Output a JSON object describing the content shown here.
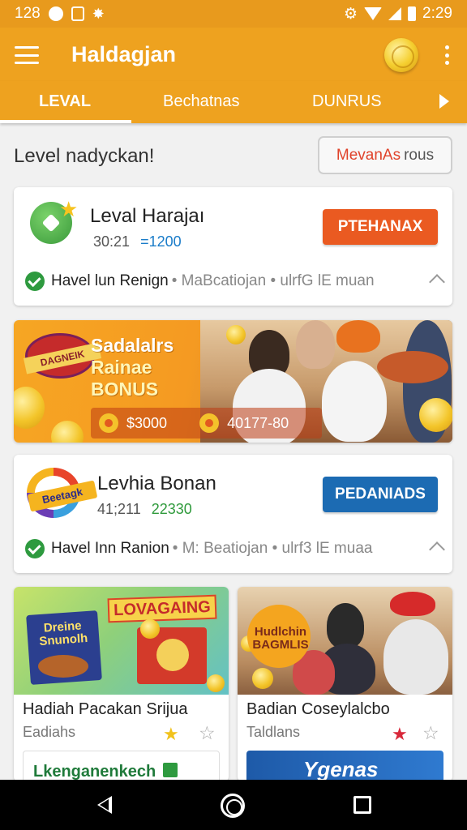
{
  "status_bar": {
    "left_text": "128",
    "time": "2:29",
    "icons": [
      "notification-icon",
      "grid-icon",
      "star-icon",
      "settings-icon",
      "wifi-icon",
      "signal-icon",
      "battery-icon"
    ]
  },
  "app_bar": {
    "title": "Haldagjan",
    "icons": [
      "menu-icon",
      "coin-icon",
      "more-vert-icon"
    ]
  },
  "tabs": [
    {
      "label": "LEVAL",
      "selected": true
    },
    {
      "label": "Bechatnas",
      "selected": false
    },
    {
      "label": "DUNRUS",
      "selected": false
    }
  ],
  "section": {
    "title": "Level nadyckan!",
    "button_label": "MevanAs",
    "button_suffix": "rous"
  },
  "card1": {
    "title": "Leval Harajaı",
    "meta_time": "30:21",
    "meta_value": "=1200",
    "button": "PTEHANAX",
    "footer_strong": "Havel lun Renign",
    "footer_rest": "• MaBcatiojan • ulrfG lE muan"
  },
  "banner": {
    "badge": "DAGNEIK",
    "title_l1": "Sadalalrs",
    "title_l2": "Rainae",
    "title_l3": "BONUS",
    "pill_a": "$3000",
    "pill_b": "40177-80"
  },
  "card2": {
    "title": "Levhia Bonan",
    "meta_time": "41;211",
    "meta_value": "22330",
    "badge": "Beetagk",
    "button": "PEDANIADS",
    "footer_strong": "Havel Inn Ranion",
    "footer_rest": "• M: Beatiojan • ulrf3 lE muaa"
  },
  "grid": [
    {
      "ribbon": "LOVAGAING",
      "box_label": "Dreine Snunolh",
      "title": "Hadiah Pacakan Srijua",
      "subtitle": "Eadiahs",
      "strip": "Lkenganenkech",
      "star_color": "#f1c21c"
    },
    {
      "badge": "Hudlchin BAGMLIS",
      "title": "Badian Coseylalcbo",
      "subtitle": "Taldlans",
      "strip": "Ygenas",
      "star_color": "#d8283a"
    }
  ],
  "colors": {
    "primary": "#eea21f",
    "accent_orange": "#ea5a21",
    "accent_blue": "#1c6bb3",
    "success": "#2e9a3f"
  },
  "nav": {
    "icons": [
      "back-icon",
      "home-icon",
      "recents-icon"
    ]
  }
}
